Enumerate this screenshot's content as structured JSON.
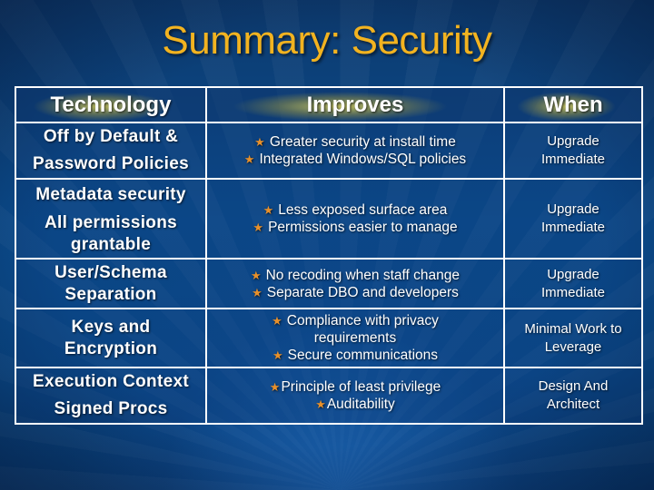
{
  "slide": {
    "title": "Summary: Security",
    "bullet_icon": "star-icon",
    "colors": {
      "title": "#f2b320",
      "bullet_star": "#e8902a",
      "text": "#ffffff",
      "background": "#0b4d8f",
      "grid": "#ffffff"
    }
  },
  "table": {
    "headers": [
      "Technology",
      "Improves",
      "When"
    ],
    "rows": [
      {
        "technology": [
          "Off by Default &",
          "Password Policies"
        ],
        "improves": [
          "Greater security at install time",
          "Integrated Windows/SQL policies"
        ],
        "when": [
          "Upgrade",
          "Immediate"
        ]
      },
      {
        "technology": [
          "Metadata security",
          "All permissions",
          "grantable"
        ],
        "improves": [
          "Less exposed surface area",
          "Permissions easier to manage"
        ],
        "when": [
          "Upgrade",
          "Immediate"
        ]
      },
      {
        "technology": [
          "User/Schema",
          "Separation"
        ],
        "improves": [
          "No recoding when staff change",
          "Separate DBO and developers"
        ],
        "when": [
          "Upgrade",
          "Immediate"
        ]
      },
      {
        "technology": [
          "Keys and",
          "Encryption"
        ],
        "improves": [
          "Compliance with privacy",
          "requirements",
          "Secure communications"
        ],
        "when": [
          "Minimal Work to",
          "Leverage"
        ]
      },
      {
        "technology": [
          "Execution Context",
          "Signed Procs"
        ],
        "improves": [
          "Principle of least privilege",
          "Auditability"
        ],
        "when": [
          "Design And",
          "Architect"
        ]
      }
    ]
  }
}
